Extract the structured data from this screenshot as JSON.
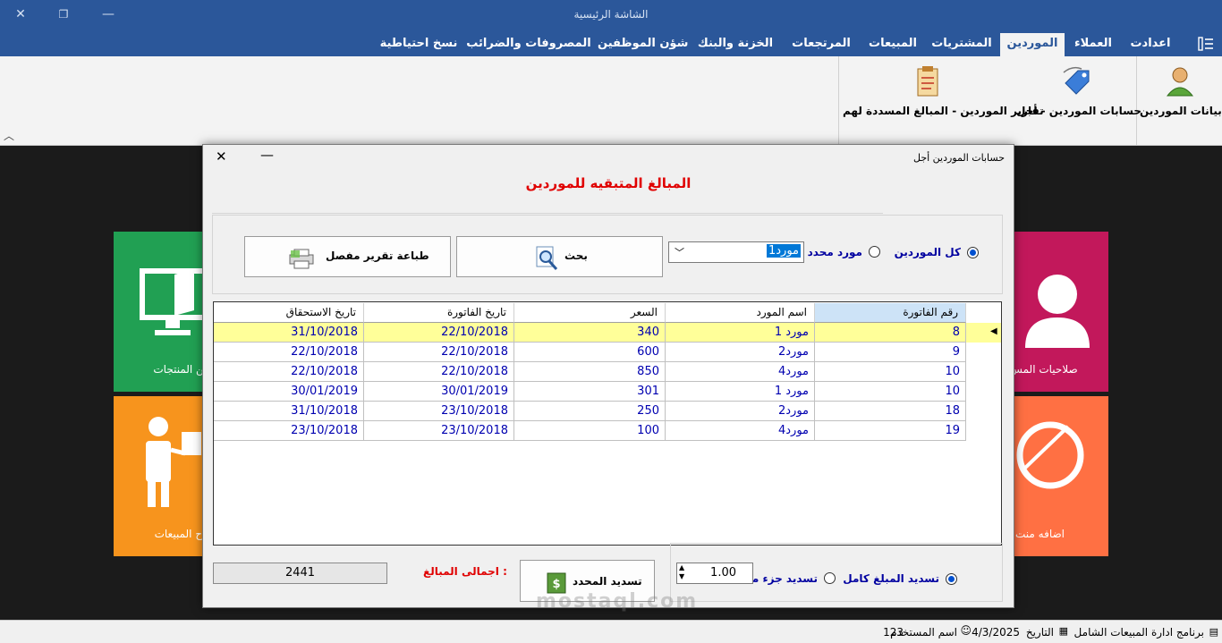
{
  "window": {
    "title": "الشاشة الرئيسية"
  },
  "tabs": [
    {
      "label": "اعدادت"
    },
    {
      "label": "العملاء"
    },
    {
      "label": "الموردين"
    },
    {
      "label": "المشتريات"
    },
    {
      "label": "المبيعات"
    },
    {
      "label": "المرتجعات"
    },
    {
      "label": "الخزنة والبنك"
    },
    {
      "label": "شؤن الموظفين"
    },
    {
      "label": "المصروفات والضرائب"
    },
    {
      "label": "نسخ احتياطية"
    }
  ],
  "ribbon": {
    "suppliers_data": "بيانات الموردين",
    "suppliers_accounts": "حسابات الموردين - أجل",
    "suppliers_reports": "تقارير الموردين - المبالغ المسددة لهم"
  },
  "tiles": {
    "products": "من المنتجات",
    "permissions": "صلاحيات المس",
    "sales_profit": "اح المبيعات",
    "add_product": "اضافه منت"
  },
  "dialog": {
    "title": "حسابات الموردين أجل",
    "heading": "المبالغ المتبقيه للموردين",
    "all_suppliers": "كل الموردين",
    "specific_supplier": "مورد محدد",
    "supplier_combo_value": "مورد1",
    "search_button": "بحث",
    "print_button": "طباعة تقرير مفصل",
    "grid": {
      "columns": [
        "رقم الفاتورة",
        "اسم المورد",
        "السعر",
        "تاريخ الفاتورة",
        "تاريخ الاستحقاق"
      ],
      "rows": [
        [
          "8",
          "مورد 1",
          "340",
          "22/10/2018",
          "31/10/2018"
        ],
        [
          "9",
          "مورد2",
          "600",
          "22/10/2018",
          "22/10/2018"
        ],
        [
          "10",
          "مورد4",
          "850",
          "22/10/2018",
          "22/10/2018"
        ],
        [
          "10",
          "مورد 1",
          "301",
          "30/01/2019",
          "30/01/2019"
        ],
        [
          "18",
          "مورد2",
          "250",
          "23/10/2018",
          "31/10/2018"
        ],
        [
          "19",
          "مورد4",
          "100",
          "23/10/2018",
          "23/10/2018"
        ]
      ]
    },
    "pay_full": "تسديد المبلغ كامل",
    "pay_part": "تسديد جزء منه",
    "amount_value": "1.00",
    "pay_selected_button": "تسديد المحدد",
    "total_label": "اجمالى المبالغ :",
    "total_value": "2441"
  },
  "watermark": "mostaql.com",
  "status": {
    "program": "برنامج ادارة المبيعات الشامل",
    "date_label": "التاريخ",
    "date_value": "4/3/2025",
    "user_label": "اسم المستخدم",
    "user_value": "123"
  },
  "colors": {
    "accent": "#2b579a",
    "selected_row": "#ffff99",
    "heading": "#e00000"
  }
}
